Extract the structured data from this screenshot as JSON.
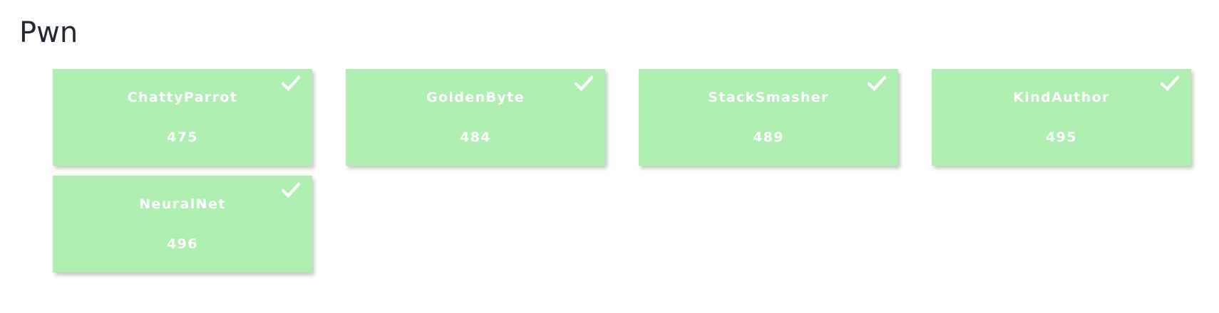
{
  "category": {
    "title": "Pwn"
  },
  "challenges": [
    {
      "name": "ChattyParrot",
      "points": "475",
      "status_icon": "check-icon"
    },
    {
      "name": "GoldenByte",
      "points": "484",
      "status_icon": "check-icon"
    },
    {
      "name": "StackSmasher",
      "points": "489",
      "status_icon": "check-icon"
    },
    {
      "name": "KindAuthor",
      "points": "495",
      "status_icon": "check-icon"
    },
    {
      "name": "NeuralNet",
      "points": "496",
      "status_icon": "check-icon"
    }
  ],
  "colors": {
    "solved_card_background": "#b0efb2",
    "card_text": "#ffffff",
    "title_text": "#222831"
  }
}
